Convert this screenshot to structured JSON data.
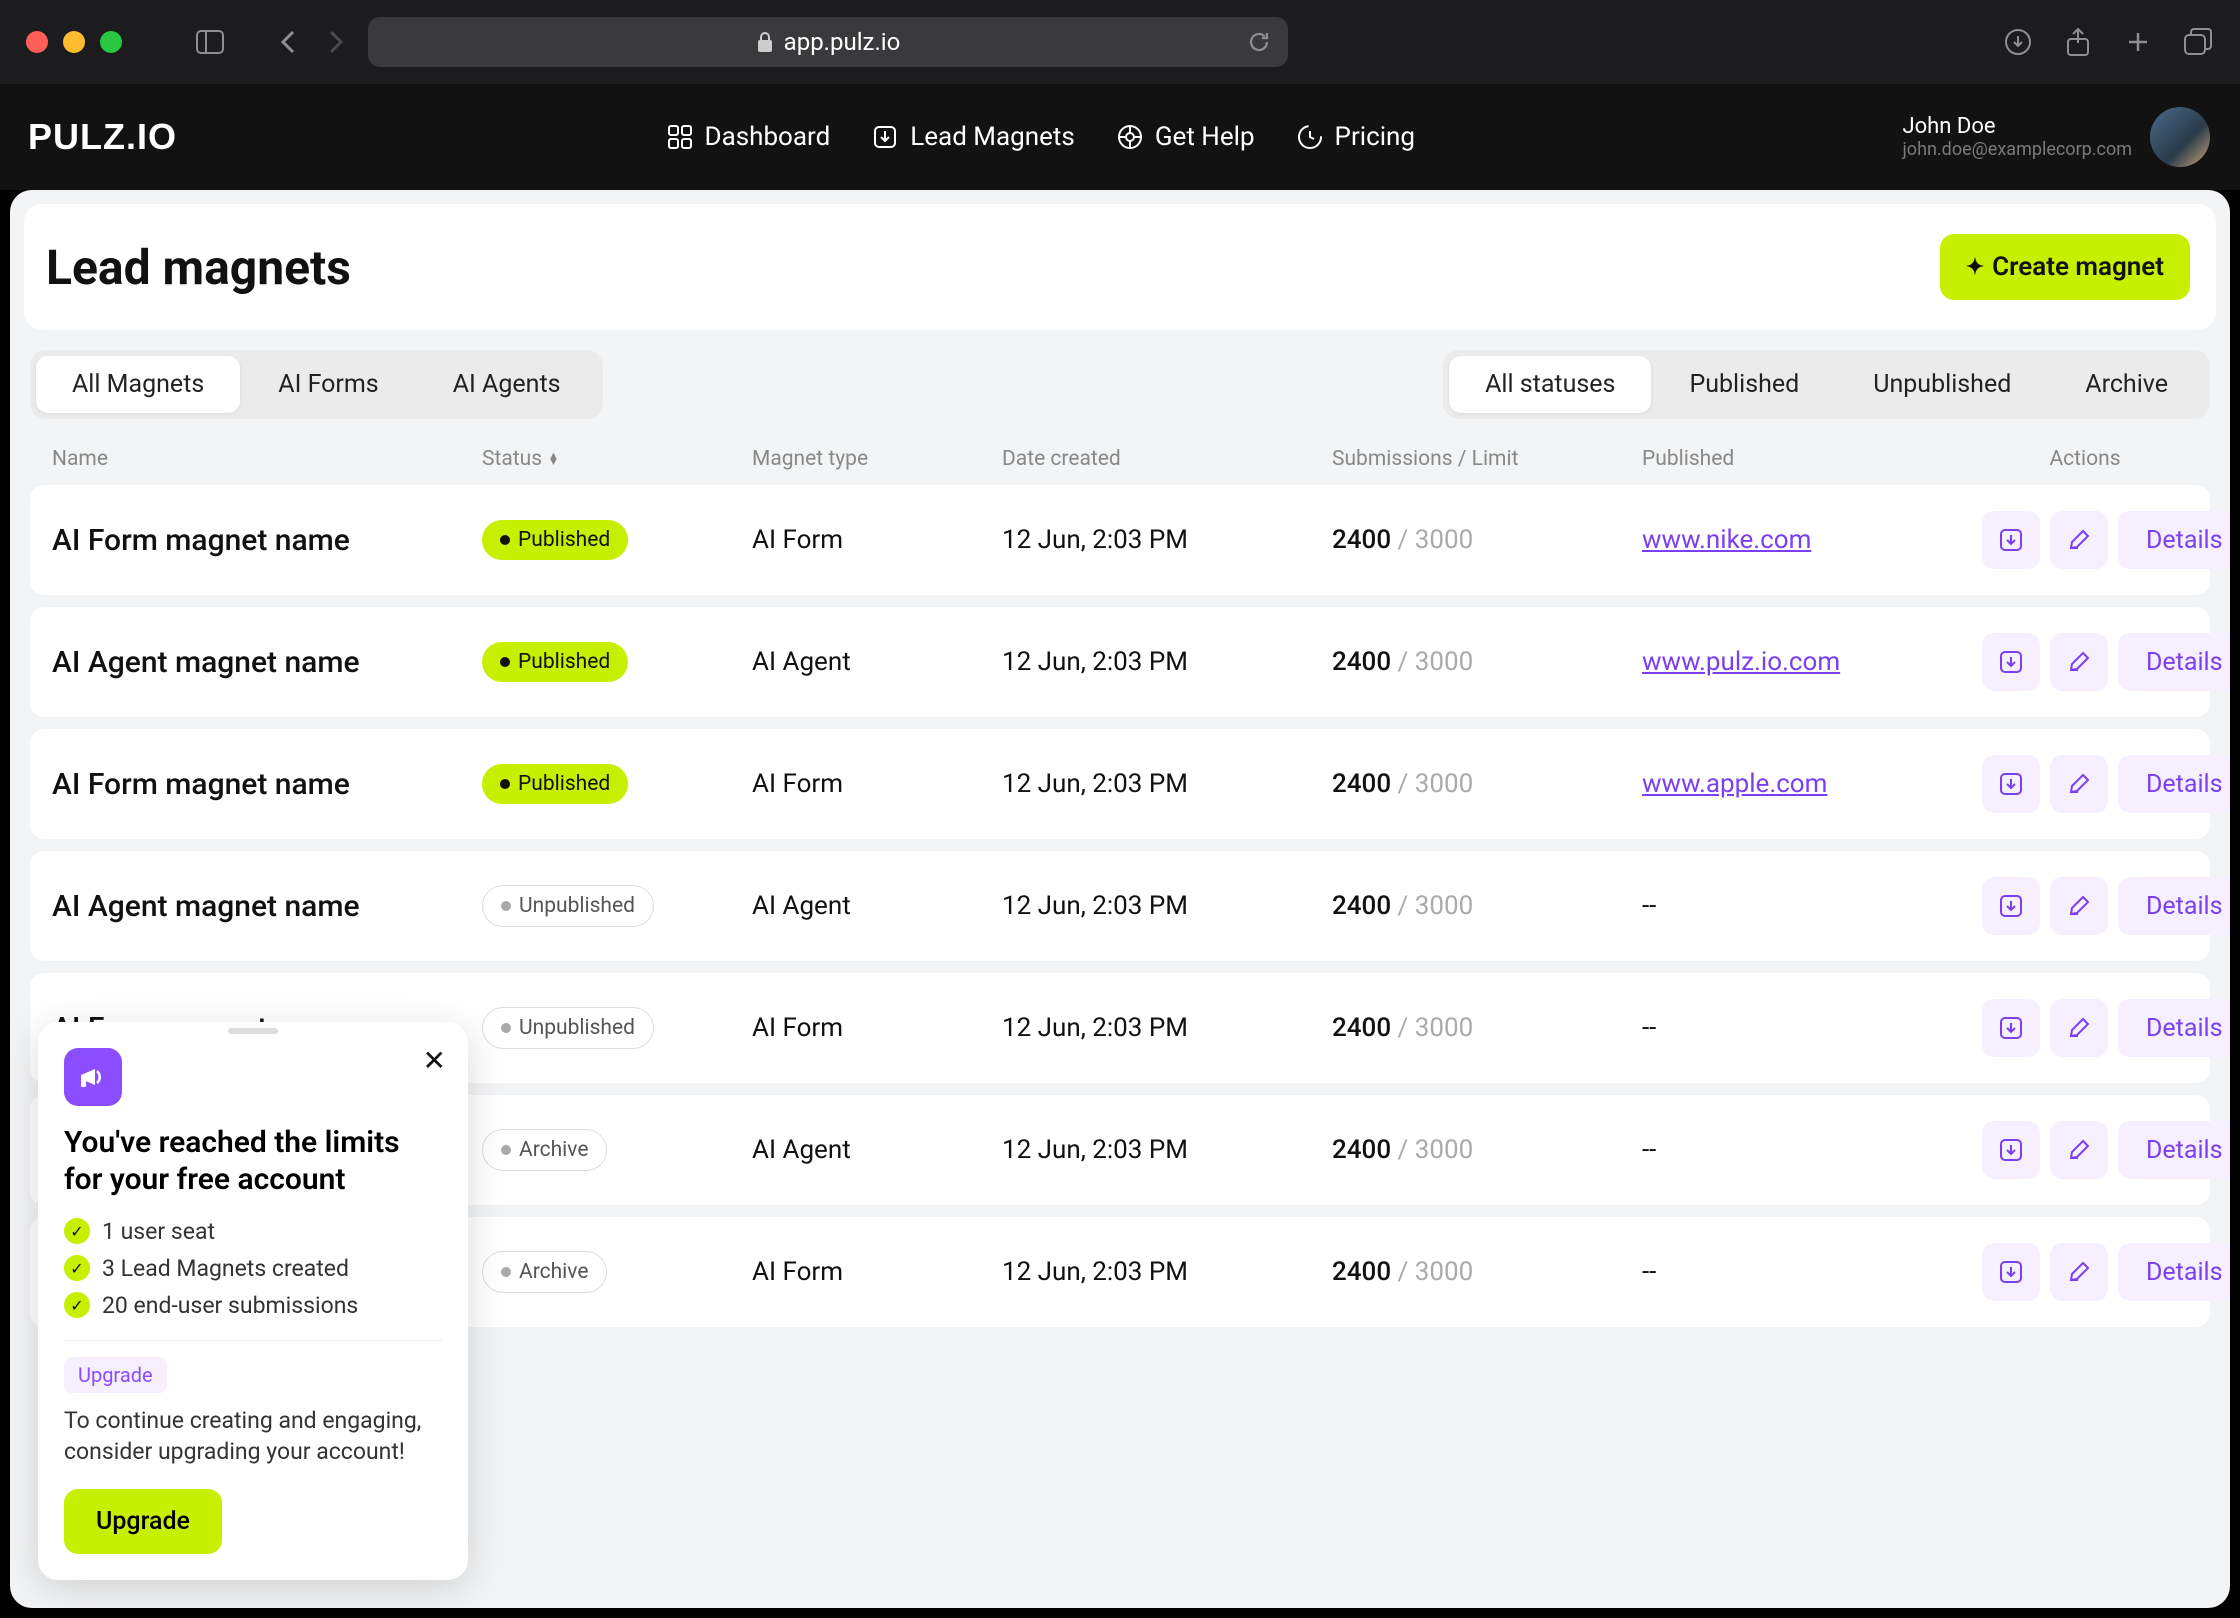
{
  "browser": {
    "url": "app.pulz.io"
  },
  "app": {
    "logo": "PULZ.IO",
    "nav": {
      "dashboard": "Dashboard",
      "lead_magnets": "Lead Magnets",
      "get_help": "Get Help",
      "pricing": "Pricing"
    },
    "user": {
      "name": "John Doe",
      "email": "john.doe@examplecorp.com"
    }
  },
  "page": {
    "title": "Lead magnets",
    "create_button": "Create magnet"
  },
  "tabs_left": {
    "all": "All Magnets",
    "forms": "AI Forms",
    "agents": "AI Agents"
  },
  "tabs_right": {
    "all": "All statuses",
    "published": "Published",
    "unpublished": "Unpublished",
    "archive": "Archive"
  },
  "columns": {
    "name": "Name",
    "status": "Status",
    "type": "Magnet type",
    "date": "Date created",
    "sub": "Submissions / Limit",
    "pub": "Published",
    "act": "Actions"
  },
  "status_labels": {
    "published": "Published",
    "unpublished": "Unpublished",
    "archive": "Archive"
  },
  "actions": {
    "details": "Details"
  },
  "rows": [
    {
      "name": "AI Form magnet name",
      "status": "published",
      "type": "AI Form",
      "date": "12 Jun, 2:03 PM",
      "used": "2400",
      "limit": "3000",
      "pub_url": "www.nike.com"
    },
    {
      "name": "AI Agent magnet name",
      "status": "published",
      "type": "AI Agent",
      "date": "12 Jun, 2:03 PM",
      "used": "2400",
      "limit": "3000",
      "pub_url": "www.pulz.io.com"
    },
    {
      "name": "AI Form magnet name",
      "status": "published",
      "type": "AI Form",
      "date": "12 Jun, 2:03 PM",
      "used": "2400",
      "limit": "3000",
      "pub_url": "www.apple.com"
    },
    {
      "name": "AI Agent magnet name",
      "status": "unpublished",
      "type": "AI Agent",
      "date": "12 Jun, 2:03 PM",
      "used": "2400",
      "limit": "3000",
      "pub_url": "--"
    },
    {
      "name": "AI Form magnet name",
      "status": "unpublished",
      "type": "AI Form",
      "date": "12 Jun, 2:03 PM",
      "used": "2400",
      "limit": "3000",
      "pub_url": "--"
    },
    {
      "name": "",
      "status": "archive",
      "type": "AI Agent",
      "date": "12 Jun, 2:03 PM",
      "used": "2400",
      "limit": "3000",
      "pub_url": "--"
    },
    {
      "name": "",
      "status": "archive",
      "type": "AI Form",
      "date": "12 Jun, 2:03 PM",
      "used": "2400",
      "limit": "3000",
      "pub_url": "--"
    }
  ],
  "popup": {
    "title": "You've reached the limits for your free account",
    "items": [
      "1 user seat",
      "3 Lead Magnets created",
      "20 end-user submissions"
    ],
    "tag": "Upgrade",
    "body": "To continue creating and engaging, consider upgrading your account!",
    "button": "Upgrade"
  }
}
